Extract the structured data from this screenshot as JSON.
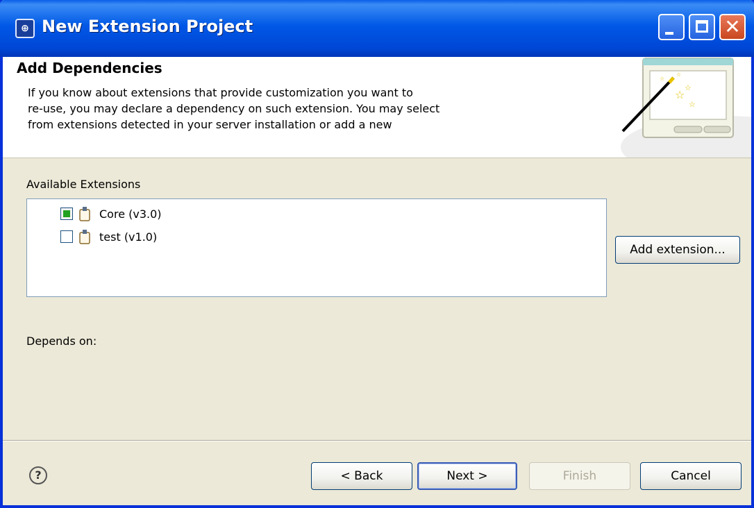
{
  "window": {
    "title": "New Extension Project",
    "icon": "hp-logo-icon",
    "app_icon_text": "⊕"
  },
  "header": {
    "title": "Add Dependencies",
    "description": "If you know about extensions that provide customization you want to\nre-use, you may declare a dependency on such extension. You may select\nfrom extensions detected in your server installation or add a new"
  },
  "available": {
    "label": "Available Extensions",
    "items": [
      {
        "label": "Core (v3.0)",
        "checked": true
      },
      {
        "label": "test (v1.0)",
        "checked": false
      }
    ],
    "add_button": "Add extension..."
  },
  "depends": {
    "label": "Depends on:"
  },
  "footer": {
    "help_glyph": "?",
    "back": "< Back",
    "next": "Next >",
    "finish": "Finish",
    "cancel": "Cancel"
  },
  "colors": {
    "title_bar": "#0058e6",
    "dialog_bg": "#ece9d8",
    "checked_fill": "#21a121"
  }
}
